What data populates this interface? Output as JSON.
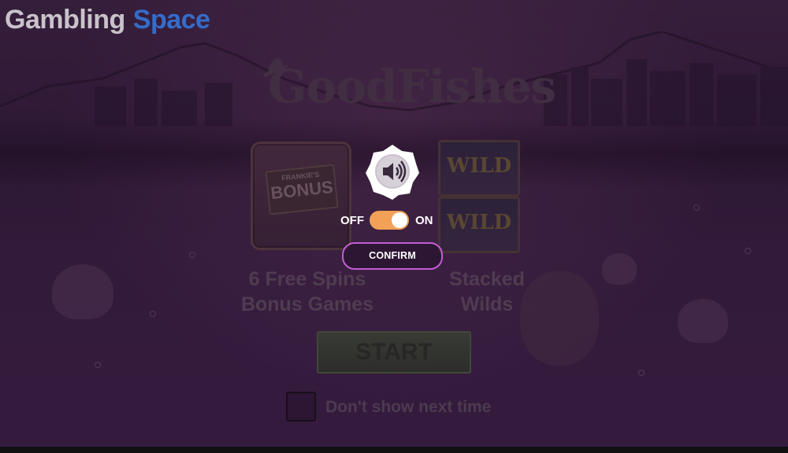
{
  "brand": {
    "word1": "Gambling",
    "word2": "Space",
    "accent": "#3a8dff"
  },
  "game": {
    "title": "GoodFishes"
  },
  "tiles": {
    "bonus": {
      "top_text": "FRANKIE'S",
      "main_text": "BONUS"
    },
    "wild_label_1": "WILD",
    "wild_label_2": "WILD"
  },
  "features": {
    "left": {
      "line1": "6 Free Spins",
      "line2": "Bonus Games"
    },
    "right": {
      "line1": "Stacked",
      "line2": "Wilds"
    }
  },
  "start_label": "START",
  "dont_show_label": "Don't show next time",
  "sound_dialog": {
    "icon": "speaker-icon",
    "off_label": "OFF",
    "on_label": "ON",
    "toggle_state": "on",
    "toggle_color": "#f2a156",
    "confirm_label": "CONFIRM",
    "confirm_border_color": "#c25fd3"
  }
}
